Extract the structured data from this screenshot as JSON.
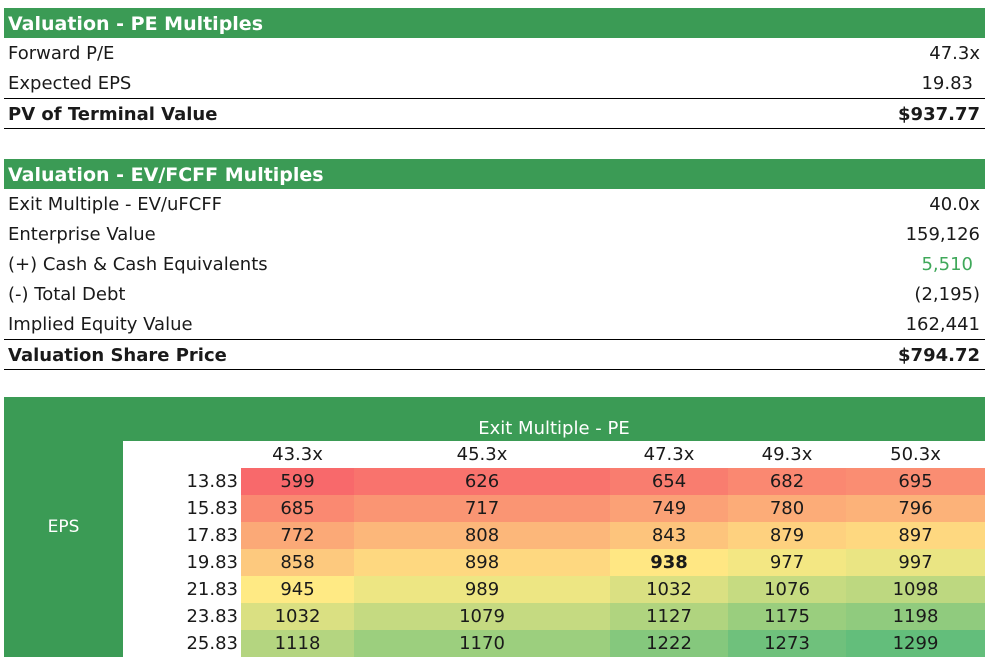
{
  "pe_section": {
    "title": "Valuation - PE Multiples",
    "rows": [
      {
        "label": "Forward P/E",
        "value": "47.3x"
      },
      {
        "label": "Expected EPS",
        "value": "19.83"
      }
    ],
    "total": {
      "label": "PV of Terminal Value",
      "value": "$937.77"
    }
  },
  "ev_section": {
    "title": "Valuation - EV/FCFF Multiples",
    "rows": [
      {
        "label": "Exit Multiple - EV/uFCFF",
        "value": "40.0x"
      },
      {
        "label": "Enterprise Value",
        "value": "159,126"
      },
      {
        "label": "(+) Cash & Cash Equivalents",
        "value": "5,510"
      },
      {
        "label": "(-) Total Debt",
        "value": "(2,195)"
      },
      {
        "label": "Implied Equity Value",
        "value": "162,441"
      }
    ],
    "total": {
      "label": "Valuation Share Price",
      "value": "$794.72"
    }
  },
  "sensitivity": {
    "title": "Exit Multiple - PE",
    "row_axis_label": "EPS",
    "columns": [
      "43.3x",
      "45.3x",
      "47.3x",
      "49.3x",
      "50.3x"
    ],
    "rows": [
      "13.83",
      "15.83",
      "17.83",
      "19.83",
      "21.83",
      "23.83",
      "25.83"
    ],
    "values": [
      [
        "599",
        "626",
        "654",
        "682",
        "695"
      ],
      [
        "685",
        "717",
        "749",
        "780",
        "796"
      ],
      [
        "772",
        "808",
        "843",
        "879",
        "897"
      ],
      [
        "858",
        "898",
        "938",
        "977",
        "997"
      ],
      [
        "945",
        "989",
        "1032",
        "1076",
        "1098"
      ],
      [
        "1032",
        "1079",
        "1127",
        "1175",
        "1198"
      ],
      [
        "1118",
        "1170",
        "1222",
        "1273",
        "1299"
      ]
    ],
    "highlight": {
      "row": 3,
      "col": 2
    },
    "color_scale": {
      "low": "#f8696b",
      "mid": "#ffeb84",
      "high": "#63be7b"
    }
  },
  "colors": {
    "header_green": "#3b9b55",
    "cash_value_green": "#3fa85a"
  }
}
